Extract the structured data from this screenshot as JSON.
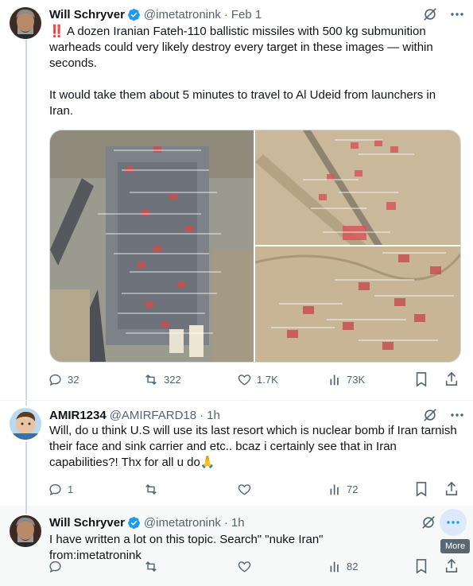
{
  "tweet1": {
    "name": "Will Schryver",
    "handle": "@imetatronink",
    "dot": "·",
    "time": "Feb 1",
    "alert": "‼️",
    "text1": "A dozen Iranian Fateh-110 ballistic missiles with 500 kg submunition warheads could very likely destroy every target in these images — within seconds.",
    "text2": "It would take them about 5 minutes to travel to Al Udeid from launchers in Iran.",
    "stats": {
      "replies": "32",
      "reposts": "322",
      "likes": "1.7K",
      "views": "73K"
    }
  },
  "tweet2": {
    "name": "AMIR1234",
    "handle": "@AMIRFARD18",
    "dot": "·",
    "time": "1h",
    "text": "Will, do u think U.S will use its last resort which is nuclear bomb if Iran tarnish their face and sink carrier and etc.. bcaz i certainly see that in Iran capabilities?! Thx for all u do🙏",
    "stats": {
      "replies": "1",
      "reposts": "",
      "likes": "",
      "views": "72"
    }
  },
  "tweet3": {
    "name": "Will Schryver",
    "handle": "@imetatronink",
    "dot": "·",
    "time": "1h",
    "text": "I have written a lot on this topic. Search\" \"nuke Iran\" from:imetatronink",
    "stats": {
      "replies": "",
      "reposts": "",
      "likes": "",
      "views": "82"
    },
    "tooltip": "More"
  },
  "colors": {
    "accent": "#1d9bf0",
    "muted": "#536471",
    "alert": "#e0245e"
  },
  "icons": [
    "grok-icon",
    "more-icon",
    "reply-icon",
    "repost-icon",
    "like-icon",
    "views-icon",
    "bookmark-icon",
    "share-icon",
    "verified-badge-icon"
  ]
}
